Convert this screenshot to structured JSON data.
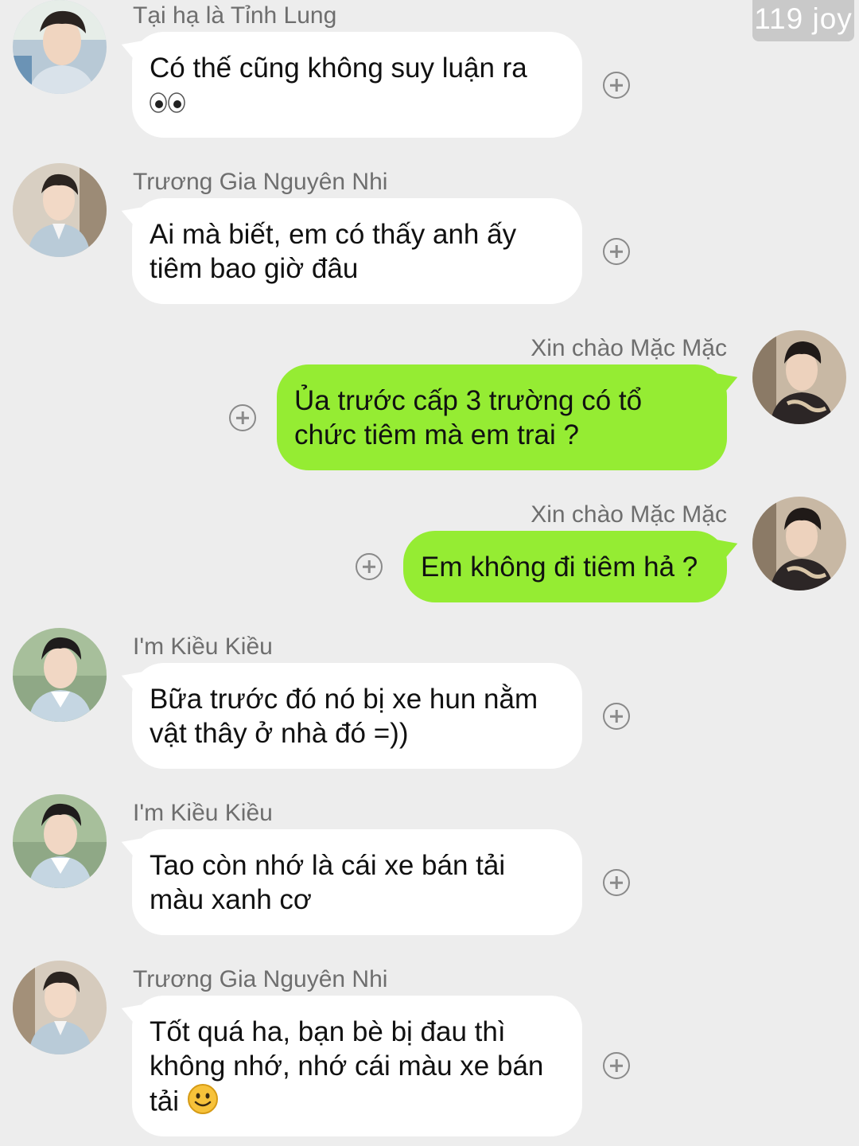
{
  "badge": {
    "text": "119 joy"
  },
  "messages": [
    {
      "sender": "Tại hạ là Tỉnh Lung",
      "lines": [
        "Có thế cũng không suy luận ra"
      ],
      "trailing_emoji": "eyes-emoji",
      "side": "left"
    },
    {
      "sender": "Trương Gia Nguyên Nhi",
      "lines": [
        "Ai mà biết, em có thấy anh ấy",
        "tiêm bao giờ đâu"
      ],
      "side": "left"
    },
    {
      "sender": "Xin chào Mặc Mặc",
      "lines": [
        "Ủa trước cấp 3 trường có tổ",
        "chức tiêm mà em trai ?"
      ],
      "side": "right"
    },
    {
      "sender": "Xin chào Mặc Mặc",
      "lines": [
        "Em không đi tiêm hả ?"
      ],
      "side": "right"
    },
    {
      "sender": "I'm Kiều Kiều",
      "lines": [
        "Bữa trước đó nó bị xe hun nằm",
        "vật thây ở nhà đó =))"
      ],
      "side": "left"
    },
    {
      "sender": "I'm Kiều Kiều",
      "lines": [
        "Tao còn nhớ là cái xe bán tải",
        "màu xanh cơ"
      ],
      "side": "left"
    },
    {
      "sender": "Trương Gia Nguyên Nhi",
      "lines": [
        "Tốt quá ha, bạn bè bị đau thì",
        "không nhớ, nhớ cái màu xe bán",
        "tải"
      ],
      "trailing_emoji": "smile-emoji",
      "side": "left"
    }
  ],
  "colors": {
    "background": "#ededed",
    "incoming_bubble": "#ffffff",
    "outgoing_bubble": "#95ec33",
    "name_text": "#6e6e6e"
  },
  "icons": {
    "add_reaction": "plus-circle-icon",
    "avatar": "user-avatar"
  }
}
